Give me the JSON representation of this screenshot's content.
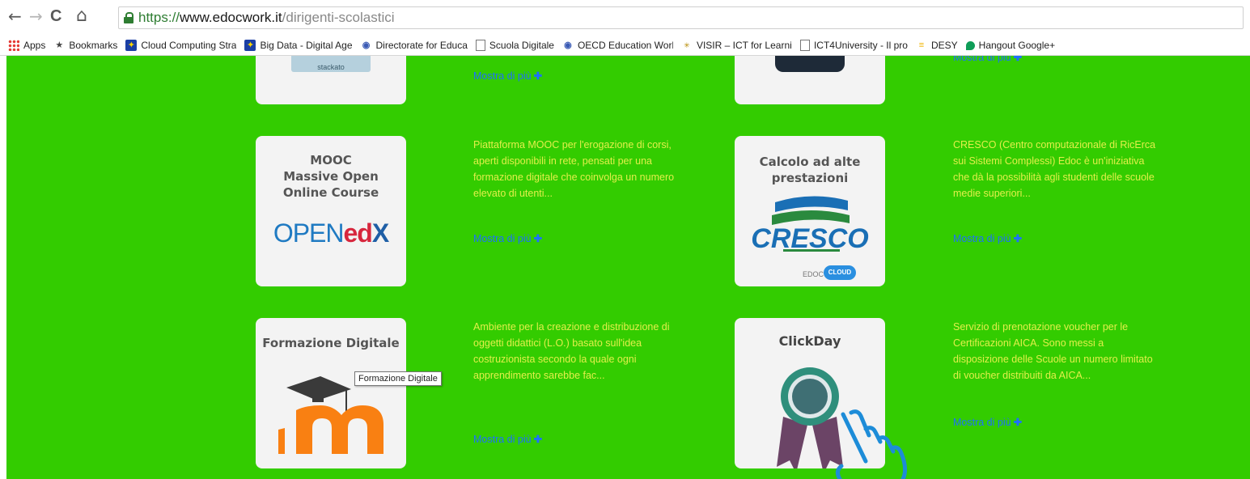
{
  "browser": {
    "url_scheme": "https://",
    "url_host": "www.edocwork.it",
    "url_path": "/dirigenti-scolastici",
    "nav": {
      "back": "←",
      "forward": "→",
      "reload": "C",
      "home": "⌂"
    }
  },
  "bookmarks": [
    {
      "label": "Apps",
      "icon": "apps-grid-icon"
    },
    {
      "label": "Bookmarks",
      "icon": "star-icon"
    },
    {
      "label": "Cloud Computing Stra",
      "icon": "eu-flag-icon"
    },
    {
      "label": "Big Data - Digital Age",
      "icon": "eu-flag-icon"
    },
    {
      "label": "Directorate for Educa",
      "icon": "oecd-icon"
    },
    {
      "label": "Scuola Digitale",
      "icon": "page-icon"
    },
    {
      "label": "OECD Education Worl",
      "icon": "oecd-icon"
    },
    {
      "label": "VISIR – ICT for Learnin",
      "icon": "visir-icon"
    },
    {
      "label": "ICT4University - Il pro",
      "icon": "page-icon"
    },
    {
      "label": "DESY",
      "icon": "desy-icon"
    },
    {
      "label": "Hangout Google+",
      "icon": "hangouts-icon"
    }
  ],
  "cards": {
    "row0_left": {
      "logo_text": "stackato",
      "more": "Mostra di più"
    },
    "row0_right": {
      "more": "Mostra di più"
    },
    "mooc": {
      "title_l1": "MOOC",
      "title_l2": "Massive Open",
      "title_l3": "Online Course",
      "logo": "OPENedX",
      "logo_a": "OPEN",
      "logo_b": "ed",
      "logo_c": "X",
      "desc": "Piattaforma MOOC per l'erogazione di corsi, aperti disponibili in rete, pensati per una formazione digitale che coinvolga un numero elevato di utenti...",
      "more": "Mostra di più"
    },
    "cresco": {
      "title_l1": "Calcolo ad alte",
      "title_l2": "prestazioni",
      "logo": "CRESCO",
      "sub": "EDOC",
      "cloud": "CLOUD",
      "desc": "CRESCO (Centro computazionale di RicErca sui Sistemi Complessi) Edoc è un'iniziativa che dà la possibilità agli studenti delle scuole medie superiori...",
      "more": "Mostra di più"
    },
    "formazione": {
      "title": "Formazione Digitale",
      "desc": "Ambiente per la creazione e distribuzione di oggetti didattici (L.O.) basato sull'idea costruzionista secondo la quale ogni apprendimento sarebbe fac...",
      "more": "Mostra di più",
      "tooltip": "Formazione Digitale"
    },
    "clickday": {
      "title": "ClickDay",
      "desc": "Servizio di prenotazione voucher per le Certificazioni AICA. Sono messi a disposizione delle Scuole un numero limitato di voucher distribuiti da AICA...",
      "more": "Mostra di più"
    }
  },
  "colors": {
    "page_bg": "#33cc00",
    "desc_text": "#e2ef4a",
    "link": "#1e6fff",
    "card_bg": "#f3f3f3"
  }
}
